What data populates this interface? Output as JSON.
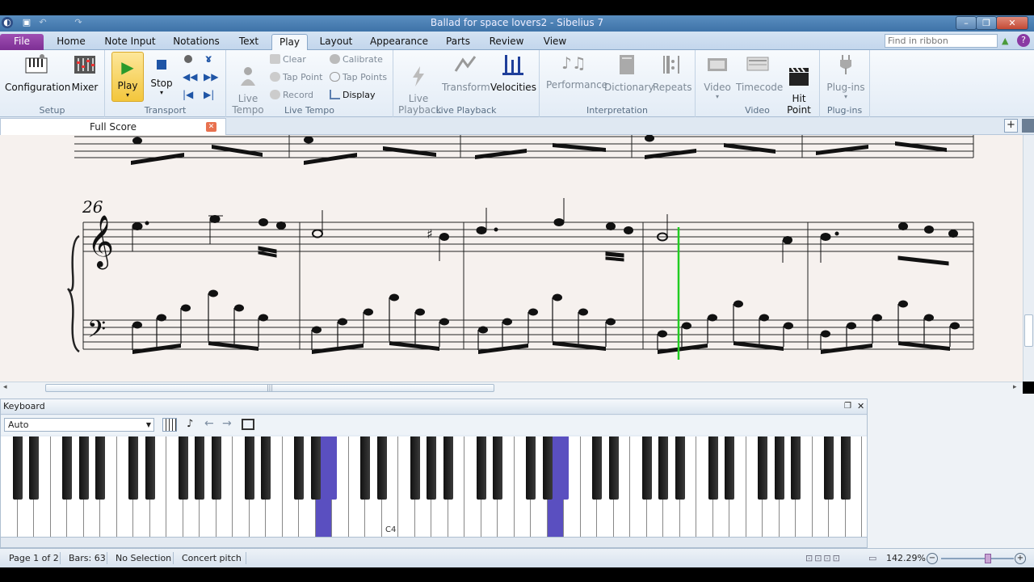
{
  "window": {
    "title": "Ballad for space lovers2 - Sibelius 7"
  },
  "tabs": [
    {
      "label": "File"
    },
    {
      "label": "Home"
    },
    {
      "label": "Note Input"
    },
    {
      "label": "Notations"
    },
    {
      "label": "Text"
    },
    {
      "label": "Play"
    },
    {
      "label": "Layout"
    },
    {
      "label": "Appearance"
    },
    {
      "label": "Parts"
    },
    {
      "label": "Review"
    },
    {
      "label": "View"
    }
  ],
  "active_tab": "Play",
  "find_placeholder": "Find in ribbon",
  "ribbon": {
    "setup": {
      "label": "Setup",
      "configuration": "Configuration",
      "mixer": "Mixer"
    },
    "transport": {
      "label": "Transport",
      "play": "Play",
      "stop": "Stop"
    },
    "live_tempo": {
      "label": "Live Tempo",
      "live_tempo": "Live\nTempo",
      "clear": "Clear",
      "tap_point": "Tap Point",
      "record": "Record",
      "calibrate": "Calibrate",
      "tap_points": "Tap Points",
      "display": "Display"
    },
    "live_playback": {
      "label": "Live Playback",
      "live_playback": "Live\nPlayback",
      "transform": "Transform",
      "velocities": "Velocities"
    },
    "interpretation": {
      "label": "Interpretation",
      "performance": "Performance",
      "dictionary": "Dictionary",
      "repeats": "Repeats"
    },
    "video": {
      "label": "Video",
      "video": "Video",
      "timecode": "Timecode",
      "hit_point": "Hit\nPoint"
    },
    "plugins": {
      "label": "Plug-ins",
      "plugins": "Plug-ins"
    }
  },
  "document_tab": "Full Score",
  "score": {
    "bar_number": "26"
  },
  "keyboard": {
    "title": "Keyboard",
    "mode": "Auto",
    "middle_c_label": "C4",
    "colors": {
      "highlight": "#5a4fc0"
    }
  },
  "status": {
    "page": "Page 1 of 2",
    "bars": "Bars: 63",
    "selection": "No Selection",
    "pitch": "Concert pitch",
    "zoom": "142.29%"
  },
  "colors": {
    "file_tab": "#8a3aa3",
    "playback_line": "#22cc22",
    "play_button": "#f5d24a"
  }
}
